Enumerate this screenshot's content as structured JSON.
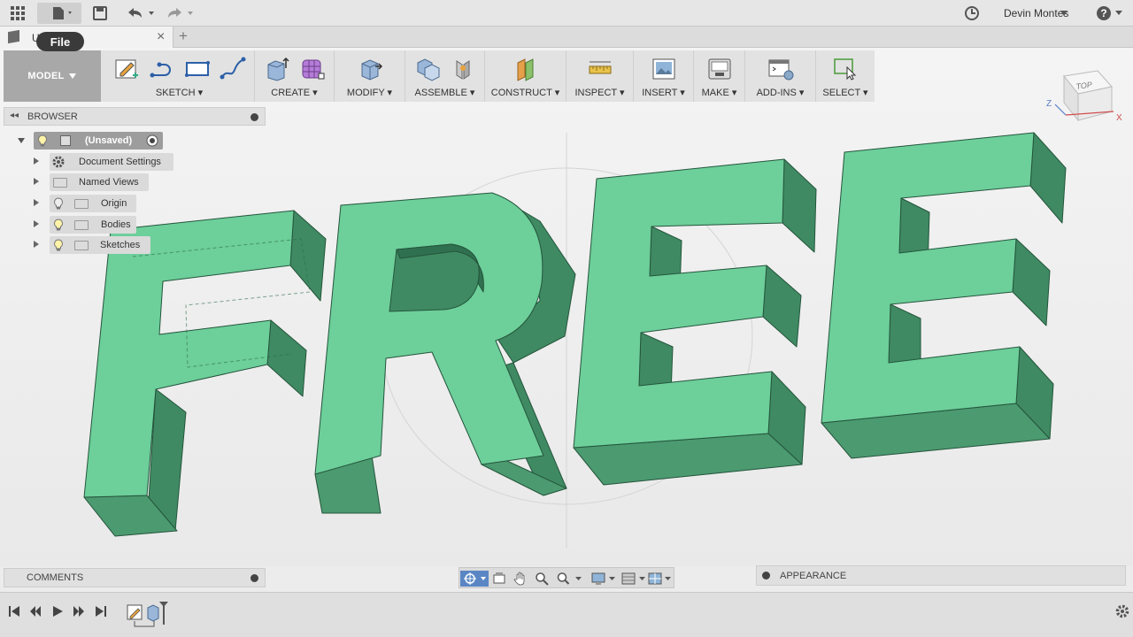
{
  "app": {
    "document_tab": "U",
    "tooltip": "File",
    "user": "Devin Montes"
  },
  "toolbar": {
    "workspace": "MODEL",
    "groups": [
      {
        "label": "SKETCH"
      },
      {
        "label": "CREATE"
      },
      {
        "label": "MODIFY"
      },
      {
        "label": "ASSEMBLE"
      },
      {
        "label": "CONSTRUCT"
      },
      {
        "label": "INSPECT"
      },
      {
        "label": "INSERT"
      },
      {
        "label": "MAKE"
      },
      {
        "label": "ADD-INS"
      },
      {
        "label": "SELECT"
      }
    ]
  },
  "browser": {
    "title": "BROWSER",
    "root": "(Unsaved)",
    "items": [
      {
        "label": "Document Settings"
      },
      {
        "label": "Named Views"
      },
      {
        "label": "Origin"
      },
      {
        "label": "Bodies"
      },
      {
        "label": "Sketches"
      }
    ]
  },
  "viewcube": {
    "face": "TOP",
    "axis_x": "X",
    "axis_z": "Z"
  },
  "panels": {
    "comments": "COMMENTS",
    "appearance": "APPEARANCE"
  },
  "model": {
    "text": "FREE",
    "color_front": "#6dcf9a",
    "color_side": "#3f8a62",
    "color_top": "#5bb886",
    "edge": "#24553c"
  }
}
